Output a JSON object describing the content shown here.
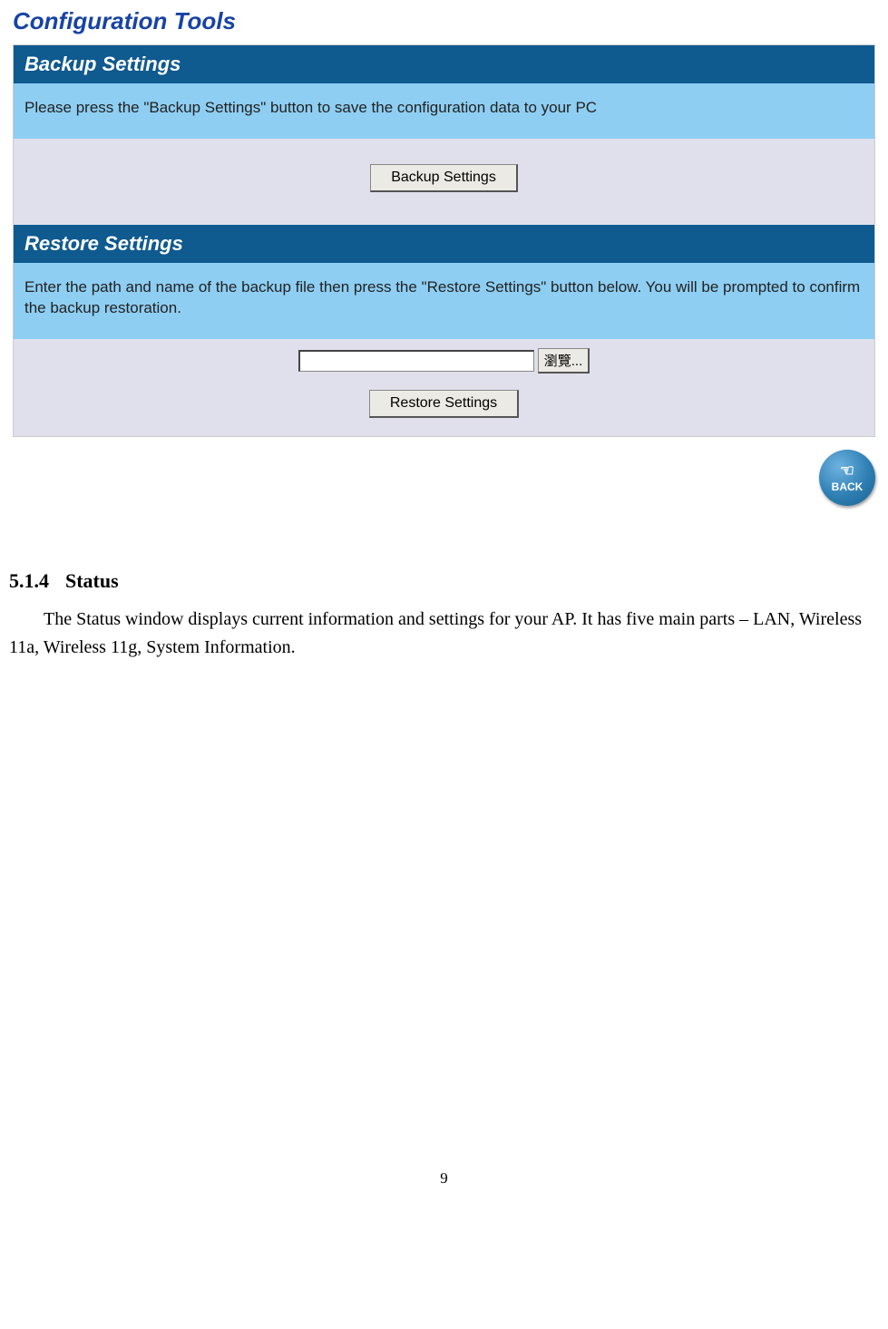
{
  "page_title": "Configuration Tools",
  "backup": {
    "header": "Backup Settings",
    "info": "Please press the \"Backup Settings\" button to save the configuration data to your PC",
    "button": "Backup Settings"
  },
  "restore": {
    "header": "Restore Settings",
    "info": "Enter the path and name of the backup file then press the \"Restore Settings\" button below. You will be prompted to confirm the backup restoration.",
    "file_value": "",
    "browse_label": "瀏覽...",
    "button": "Restore Settings"
  },
  "back": {
    "label": "BACK"
  },
  "doc": {
    "section_number": "5.1.4",
    "section_title": "Status",
    "body": "The Status window displays current information and settings for your AP. It has five main parts – LAN, Wireless 11a, Wireless 11g, System Information."
  },
  "page_number": "9"
}
